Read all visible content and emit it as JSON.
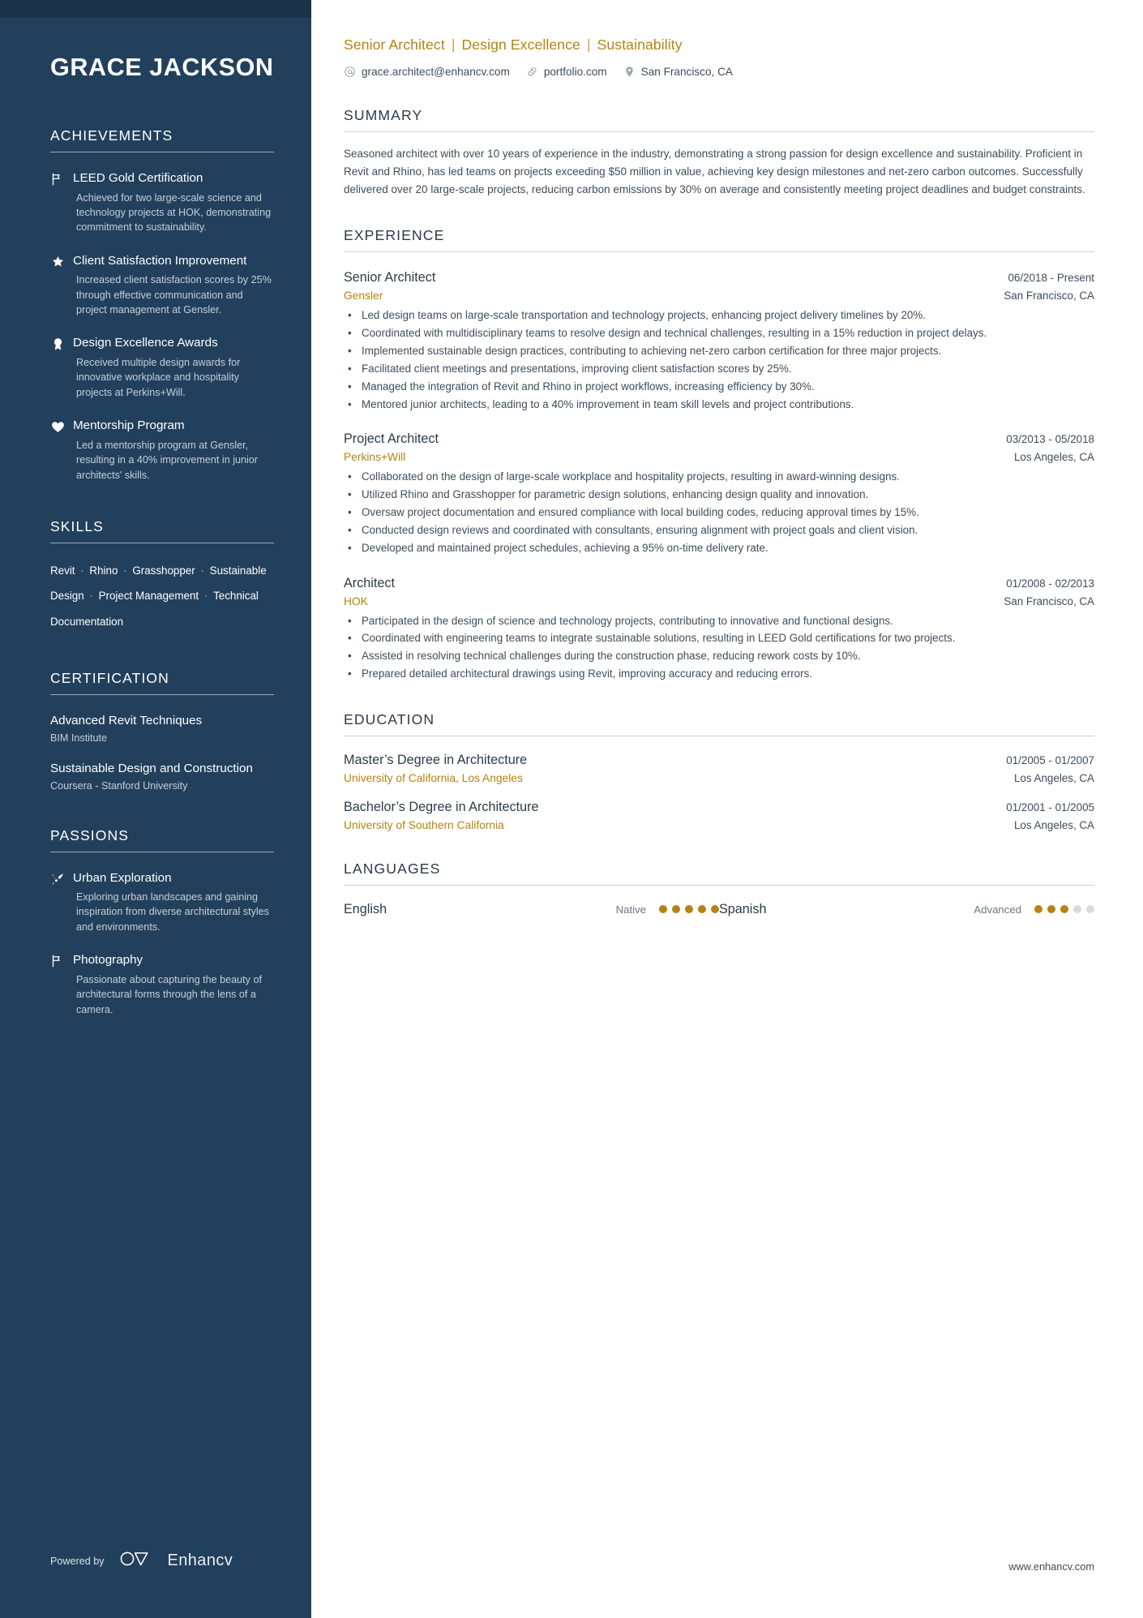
{
  "sidebar": {
    "name": "GRACE JACKSON",
    "achievements": {
      "title": "ACHIEVEMENTS",
      "items": [
        {
          "icon": "flag-icon",
          "title": "LEED Gold Certification",
          "desc": "Achieved for two large-scale science and technology projects at HOK, demonstrating commitment to sustainability."
        },
        {
          "icon": "star-icon",
          "title": "Client Satisfaction Improvement",
          "desc": "Increased client satisfaction scores by 25% through effective communication and project management at Gensler."
        },
        {
          "icon": "award-icon",
          "title": "Design Excellence Awards",
          "desc": "Received multiple design awards for innovative workplace and hospitality projects at Perkins+Will."
        },
        {
          "icon": "heart-icon",
          "title": "Mentorship Program",
          "desc": "Led a mentorship program at Gensler, resulting in a 40% improvement in junior architects' skills."
        }
      ]
    },
    "skills": {
      "title": "SKILLS",
      "items": [
        "Revit",
        "Rhino",
        "Grasshopper",
        "Sustainable Design",
        "Project Management",
        "Technical Documentation"
      ],
      "separator": "·"
    },
    "certification": {
      "title": "CERTIFICATION",
      "items": [
        {
          "name": "Advanced Revit Techniques",
          "org": "BIM Institute"
        },
        {
          "name": "Sustainable Design and Construction",
          "org": "Coursera - Stanford University"
        }
      ]
    },
    "passions": {
      "title": "PASSIONS",
      "items": [
        {
          "icon": "comet-icon",
          "title": "Urban Exploration",
          "desc": "Exploring urban landscapes and gaining inspiration from diverse architectural styles and environments."
        },
        {
          "icon": "flag-icon",
          "title": "Photography",
          "desc": "Passionate about capturing the beauty of architectural forms through the lens of a camera."
        }
      ]
    },
    "footer": {
      "powered_by": "Powered by",
      "brand": "Enhancv",
      "brand_logo_icon": "enhancv-logo-icon"
    }
  },
  "main": {
    "headline": {
      "parts": [
        "Senior Architect",
        "Design Excellence",
        "Sustainability"
      ],
      "separator": "|",
      "color": "#b58410"
    },
    "contact": [
      {
        "icon": "email-icon",
        "text": "grace.architect@enhancv.com"
      },
      {
        "icon": "link-icon",
        "text": "portfolio.com"
      },
      {
        "icon": "location-pin-icon",
        "text": "San Francisco, CA"
      }
    ],
    "summary": {
      "title": "SUMMARY",
      "text": "Seasoned architect with over 10 years of experience in the industry, demonstrating a strong passion for design excellence and sustainability. Proficient in Revit and Rhino, has led teams on projects exceeding $50 million in value, achieving key design milestones and net-zero carbon outcomes. Successfully delivered over 20 large-scale projects, reducing carbon emissions by 30% on average and consistently meeting project deadlines and budget constraints."
    },
    "experience": {
      "title": "EXPERIENCE",
      "jobs": [
        {
          "role": "Senior Architect",
          "dates": "06/2018 - Present",
          "company": "Gensler",
          "location": "San Francisco, CA",
          "bullets": [
            "Led design teams on large-scale transportation and technology projects, enhancing project delivery timelines by 20%.",
            "Coordinated with multidisciplinary teams to resolve design and technical challenges, resulting in a 15% reduction in project delays.",
            "Implemented sustainable design practices, contributing to achieving net-zero carbon certification for three major projects.",
            "Facilitated client meetings and presentations, improving client satisfaction scores by 25%.",
            "Managed the integration of Revit and Rhino in project workflows, increasing efficiency by 30%.",
            "Mentored junior architects, leading to a 40% improvement in team skill levels and project contributions."
          ]
        },
        {
          "role": "Project Architect",
          "dates": "03/2013 - 05/2018",
          "company": "Perkins+Will",
          "location": "Los Angeles, CA",
          "bullets": [
            "Collaborated on the design of large-scale workplace and hospitality projects, resulting in award-winning designs.",
            "Utilized Rhino and Grasshopper for parametric design solutions, enhancing design quality and innovation.",
            "Oversaw project documentation and ensured compliance with local building codes, reducing approval times by 15%.",
            "Conducted design reviews and coordinated with consultants, ensuring alignment with project goals and client vision.",
            "Developed and maintained project schedules, achieving a 95% on-time delivery rate."
          ]
        },
        {
          "role": "Architect",
          "dates": "01/2008 - 02/2013",
          "company": "HOK",
          "location": "San Francisco, CA",
          "bullets": [
            "Participated in the design of science and technology projects, contributing to innovative and functional designs.",
            "Coordinated with engineering teams to integrate sustainable solutions, resulting in LEED Gold certifications for two projects.",
            "Assisted in resolving technical challenges during the construction phase, reducing rework costs by 10%.",
            "Prepared detailed architectural drawings using Revit, improving accuracy and reducing errors."
          ]
        }
      ]
    },
    "education": {
      "title": "EDUCATION",
      "items": [
        {
          "degree": "Master’s Degree in Architecture",
          "dates": "01/2005 - 01/2007",
          "school": "University of California, Los Angeles",
          "location": "Los Angeles, CA"
        },
        {
          "degree": "Bachelor’s Degree in Architecture",
          "dates": "01/2001 - 01/2005",
          "school": "University of Southern California",
          "location": "Los Angeles, CA"
        }
      ]
    },
    "languages": {
      "title": "LANGUAGES",
      "items": [
        {
          "name": "English",
          "level": "Native",
          "filled": 5,
          "total": 5
        },
        {
          "name": "Spanish",
          "level": "Advanced",
          "filled": 3,
          "total": 5
        }
      ]
    },
    "site_url": "www.enhancv.com"
  }
}
